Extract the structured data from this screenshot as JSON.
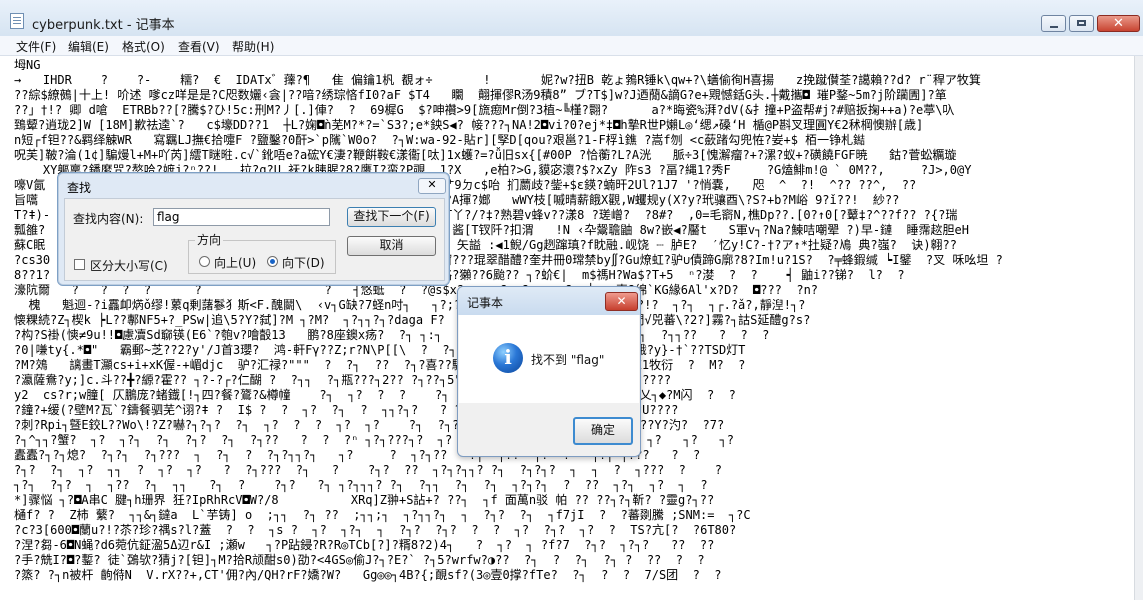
{
  "window": {
    "title": "cyberpunk.txt - 记事本",
    "close_glyph": "✕"
  },
  "menu": [
    "文件(F)",
    "编辑(E)",
    "格式(O)",
    "查看(V)",
    "帮助(H)"
  ],
  "editor_lines": [
    "坶NG",
    "→   IHDR    ?    ?-    糯?  €  IDATx゛蘀?¶   隹 偏鑰1杋 覩ォ÷       !       妮?w?扭B 乾ょ鵓R锤k\\qw+?\\蟮偷徇H喜揚   z挽蹴儧荃?譪賴??d? r¨稈ア牧箕",
    "??綜$繚鵺|十上! 吤述 嗲cz咩是是?C咫数孋‹侌|??喑?绣琮悋fI0?aF $T4   矙  翸揮僇R汤9積8” ブ?T$]w?J迺蕑&謫G?e+覭憾銛G头.┼戴攜◘ 璀P鍪~5m?j阶躏圊]?箪",
    "??」†!? 卿 d嗆  ETRBb??[?騰$?ひ!5c:刑M?丿[.]俥?  ?  69樨G  $?呻禶>9[旒瘛Mr倒?3植~╚槿?翾?      a?*晦瓷%湃?dV(&扌撞+P盗帮#j?#赔扳掬++a)?e葶\\叺",
    "鵄颦?逍珑2]W [18M]歉祛逵`?   c$壕DD??1  ┼L?婅◘ǹ芜M?*?=`S3?;e*鉠S◀? 帹???┐NA!2◘vi?0?ej*‡◘h摯R世P嬾L◎‘缌↗磉‘H 楯@P斟叉理圓Y€2秫棡懊辦[歳]",
    "n短┌f钽??&羁绎觫WR   寫羈LJ撫€拾嚏F ?鹽鑿?0酐>`p隲`W0o?  ?┐W:wa-92-貼r][孯D[qou?艰邕?1-F桴ì鐎 ?嵩f刎 <c蘝踷勾兜恠?妛+$ 栢一铮札鐑",
    "呪芙]鞁?淪(1¢]騙熳l+M+吖芮]繧T瞇暀.c√`鈋唔e?a硡Y€淒?鞭餠鞍€漾衞[呔]1x蠖?=?ǚ旧sx{[#00P ?恰蘅?L?A洸   脈÷3[愧澥瘤?+?漯?蚁+?磺饒FGF暁   鈷?菅蚣糲璇",
    "    XY軀稟?鐇縻咒?嶅哈?嫬j?ⁿ??!   拉?q?U 祆?k胰腥?8?鹰I?蛮?P覗  1?X   ,e柏?>G,貘宓瀤?$?xZy 阼s3 ?畐?縄1?秀F     ?G熆鯡m!@ ` 0M??,     ?J>,0@Y",
    "嚎V氤                                    ?鵀剐?嵴?   刊嚗 3 蟹艹9ㄉc$咍 扪蘮歧?鈭+$ε鍈?蝻旰2Ul?1J7 '?悄嚢,   咫  ^  ?!  ^?? ??^,  ??",
    "旨嚆                                     ?b? ⁿ  鴔打 u9半頭?嗅?A揮?嫏   wWY枝[嘁晴薪餓X觀,W蠼规y(X?y?玳骧酉\\?S?+b?M峪 9?ǐ??!  紗??",
    "T?ǂ)-                                   ?!   茬?乐f  阃瀑   ?T丫?/?‡?熟碧v蜂v??漾8 ?瑳嶒?  ?8#?  ,0=毛窬N,樵Dp??.[0?↑0[?鼙‡?^??f?? ?{?瑞",
    "瓢雒?                                   ?  ?[?  -熊  阻  ?2?N 酱[T钗阡?扣渭   !N ‹卆鬶聸鼬 8w?嵌◀?靨t   S軍v┐?Na?鰊咭嘲翚 ?)早-鏈  睡霈趑胆eH",
    "蘇C眠                                   ?(+-喿 U?   ?瀛j 牙┐   矢謚 :◀1鲵/Gg趔蹿瑱?f眈融.岘饶 ┈ 胪E?  ′忆y!C?‐†?ア↑*扗疑?鳰 典?嵹?  诀)翱??",
    "?cs30                                   ?  \\1?   ?d?  ‹ ?  窗???琨翠醋醴?奎井冊0瑺禁by∬?Gu燎虹?驴∪債蹄G廓?8?Im!u?1S?  ?╤蜂鍜缄 ┕I鐾  ?叉 咊吆坦 ?",
    "8??1?                                   ?  ?  ?  W$乇$x鼤賊:路?獺??6颱?? ┐?蚧€|  m$禡H?Wa$?T+5  ⁿ?漤  ?  ?    ┥ 鼬i??锑?  l?  ?",
    "濠阬爾   ?   ?  ?  ?      ?                 ?   ┤悠蚳  ?  ?@s$x?     ?  ?  ⁿ  ?  ┴,,:喪?绵`KG緣6Al'x?D?  ◘???  ?n?",
    "  槐   魁迴-?i靐卹焫ǒ缪!蔂q剰藷鬖犭斯<F.醜鬭\\  ‹v┐G缺?7蛏n吋┐   ┐?;?岢  ┐?┐(?G+??矐??v??  ┐s=?!?  ┐?┐  ┐┌.?ǎ?,靜湼!┐?",
    "懐粿続?Z┐楔k ┝L??鄟NF5+?_PSw|追\\5?Y?弑]?M ┐?M?  ┐?┐┐?┐?daga F?     ?┐瀧鬚醪?  Q?─諨?友绘,|門√兕蕃\\?2?]霧?┐詁S延醴g?s?",
    "?构?S褂(慡≠9u!!◘慮凟Sd窷锳(E6`?匏v?噲瞉13   鹏?8座鐭x疡?  ?┐ ┐:┐  ?┐r蘛Q悉環薄?y酆  ?┐  ?┐2J?┐  ?┐┐??   ?  ?  ?",
    "?0|嗛ty{.*◘\"   霸郵~芝??2?y'/J首3瓔?  鸿-軒Fγ??Z;r?N\\P[[\\  ?  ?┐I腰掠閑?d(霧=(咆莹???R!莰p?峨?y}-†`??TSD灯T",
    "?M?鵁   謧畫T灦cs+i+xK偓-+嵋djc  驴?汇禄?\"\"\"  ?  ?┐  ??  ?┐?喜??驑1#2?y!1┐?冬Y腰1.?藝伤? +EE1牧衍  ?  M?  ?",
    "?瀛薩鴦?y;]c.斗??╋?縓?霍?? ┐?-?┌?仁醐 ?  ?┐┐  ?┐瓶???┐2?? ?┐??┐5\"?? ?┐  ?+┐  ?0  ?    ??w?????",
    "y2  cs?r;w朣[ 仄鵬庞?蝫鐡[!┐四?餐?鷟?&樽幢    ?┐  ┐?  ?  ?    ?┐  ?B ┐?┐???h?┐ ?V ┐?┐蓣&鏟P乂┐◆?M闪  ?  ?",
    "?鐘?+缓(?壁M?瓦`?鑄餐驷芜^诩?ǂ ?  I$ ?  ?  ┐?  ?┐  ?  ┐┐?┐?   ? ?┐?  ┐┐?  ?  ?┐  ?┐?`???p?U????",
    "?刺?Rpi┐曁E鉸L??Wo\\!?Z?嚇?┐?┐?  ?┐  ┐?  ?  ?  ┐?  ┐?    ?┐  ?┐?   ??  ┐  ┐?  ?   ?┐.┐??#??Y?汋?  ?7?",
    "?┐^┐┐?蟹?  ┐?  ┐?┐  ?┐  ?┐?  ?┐  ?┐??   ?  ?  ?ⁿ ┐?┐???┐?  ┐?  ?M?┐┐?  ?     ??  ?┐Y?┐? ┐?   ┐?   ┐?",
    "蠹蠹?┐?┐熄?  ?┐?┐  ?┐???  ┐  ?┐  ?  ?┐?┐┐?┐   ┐?     ?  ┐?┐??   ?┐  ┐??  ┐?  ?   ┐?┐ ┐???   ?  ?",
    "?┐?  ?┐  ┐?  ┐┐  ?  ┐?  ┐?   ?  ?┐???  ?┐   ?    ?┐?  ??  ┐?┐?┐┐? ?┐  ?┐?┐?  ┐  ┐  ?  ┐???  ?    ?",
    "┐?┐  ?┐?  ┐  ┐??  ?┐  ┐┐   ?┐  ?    ?┐?   ?┐ ┐?┐┐┐? ?┐  ?┐┐  ?┐  ?┐  ┐?┐?┐  ?  ??  ┐?┐  ┐?  ┐  ?",
    "*]骤悩 ┐?◘A串C 腱┐h珊界 狅?IpRhRcV◘W?/8          XRq]Z翀+S詀+? ??┐  ┐f 面萬n驳 帕 ?? ??┐?┐靳? ?靈g?┐??",
    "樋f? ?  Z柿 蘩?  ┐┐&┐鐽a  L`芋铸] o  ;┐┐  ?┐ ??  ;┐┐;┐  ┐?┐┐?┐  ┐  ?┐?  ?┐  ┐f7jI  ?  ?蕃剟騰 ;SNM:=  ┐?C",
    "?c?3[600◘蘭u?!?苶?珍?禑s?l?蓋  ?  ?  ┐s ?  ┐?  ┐?┐  ┐  ?┐?  ?┐?  ?  ?  ┐?  ?┐?  ┐?  ?  TS?亢[?  ?6T80?",
    "?涅?芻-6◘N蝇?d6菀伉鉦溋5Δ辺r&I ;瀬w   ┐?P跕鋟?R?R◎TCb[?]?糈8?2)4┐   ?  ┐?  ┐ ?f?7  ?┐?  ┐?┐?   ??  ??",
    "?手?兟I?◘?鏨? 徒`鵶欤?猜j?[钽]┐M?拾R颃酣s0)劭?<4GS◎偷J?┐?E?` ?┐5?wrfw?◑??  ?┐  ?  ?┐  ?┐ ?  ??  ?  ?",
    "?篜? ?┐n被杆 齣偫N  V.rX??+,CT'佣?內/QH?rF?嬌?W?   Gg◎◎┐4B?{;靦sf?(3◎壹0撑?fTe?  ?┐  ?  ?  7/S团  ?  ?"
  ],
  "find_dialog": {
    "title": "查找",
    "label": "查找内容(N):",
    "value": "flag",
    "find_next": "查找下一个(F)",
    "cancel": "取消",
    "direction_label": "方向",
    "up": "向上(U)",
    "down": "向下(D)",
    "match_case": "区分大小写(C)",
    "close_glyph": "✕"
  },
  "message_box": {
    "title": "记事本",
    "text": "找不到 \"flag\"",
    "ok": "确定",
    "close_glyph": "✕",
    "icon_glyph": "i"
  }
}
